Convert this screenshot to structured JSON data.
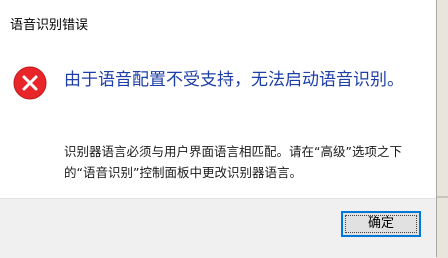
{
  "dialog": {
    "title": "语音识别错误",
    "icon": "error-icon",
    "main_instruction": "由于语音配置不受支持，无法启动语音识别。",
    "content": "识别器语言必须与用户界面语言相匹配。请在“高级”选项之下的“语音识别”控制面板中更改识别器语言。",
    "ok_label": "确定"
  },
  "colors": {
    "error_red": "#e8262a",
    "instruction_blue": "#1d3ea8",
    "button_focus": "#0078d7"
  }
}
